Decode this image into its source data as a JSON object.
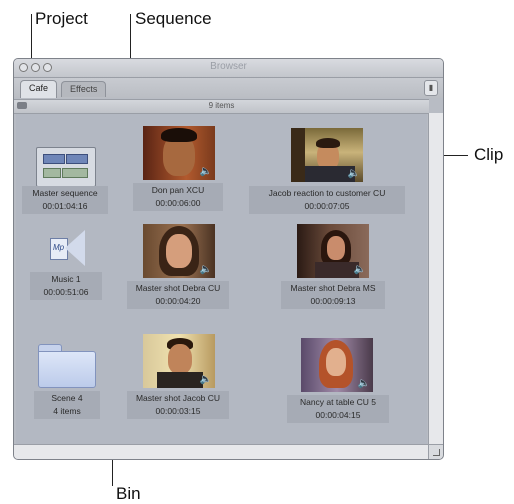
{
  "callouts": {
    "project": "Project",
    "sequence": "Sequence",
    "clip": "Clip",
    "bin": "Bin"
  },
  "window": {
    "title": "Browser",
    "tabs": [
      {
        "label": "Cafe",
        "active": true
      },
      {
        "label": "Effects",
        "active": false
      }
    ],
    "item_count": "9 items"
  },
  "items": [
    {
      "name": "Master sequence",
      "detail": "00:01:04:16",
      "kind": "sequence"
    },
    {
      "name": "Don pan XCU",
      "detail": "00:00:06:00",
      "kind": "clip"
    },
    {
      "name": "Jacob reaction to customer CU",
      "detail": "00:00:07:05",
      "kind": "clip"
    },
    {
      "name": "Music 1",
      "detail": "00:00:51:06",
      "kind": "audio"
    },
    {
      "name": "Master shot Debra CU",
      "detail": "00:00:04:20",
      "kind": "clip"
    },
    {
      "name": "Master shot Debra MS",
      "detail": "00:00:09:13",
      "kind": "clip"
    },
    {
      "name": "Scene 4",
      "detail": "4 items",
      "kind": "bin"
    },
    {
      "name": "Master shot Jacob CU",
      "detail": "00:00:03:15",
      "kind": "clip"
    },
    {
      "name": "Nancy at table CU 5",
      "detail": "00:00:04:15",
      "kind": "clip"
    }
  ],
  "colors": {
    "window_bg": "#b8bcc4",
    "content_bg": "#b3b8c2"
  }
}
